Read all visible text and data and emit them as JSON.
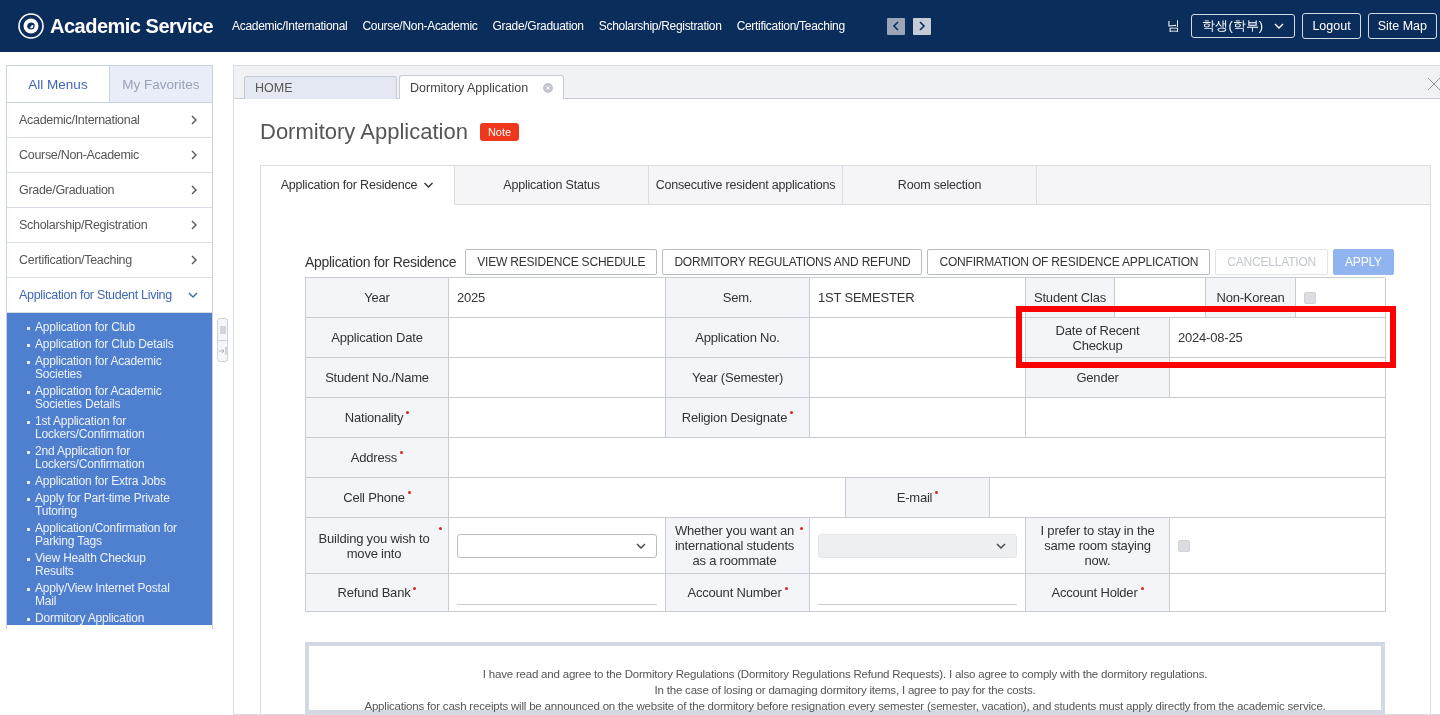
{
  "header": {
    "title": "Academic Service",
    "nav": [
      "Academic/International",
      "Course/Non-Academic",
      "Grade/Graduation",
      "Scholarship/Registration",
      "Certification/Teaching"
    ],
    "suffix": "님",
    "role_select": "학생(학부)",
    "buttons": [
      "Logout",
      "Site Map"
    ]
  },
  "sidebar": {
    "tabs": [
      {
        "label": "All Menus",
        "selected": true
      },
      {
        "label": "My Favorites",
        "selected": false
      }
    ],
    "items": [
      {
        "label": "Academic/International",
        "expanded": false
      },
      {
        "label": "Course/Non-Academic",
        "expanded": false
      },
      {
        "label": "Grade/Graduation",
        "expanded": false
      },
      {
        "label": "Scholarship/Registration",
        "expanded": false
      },
      {
        "label": "Certification/Teaching",
        "expanded": false
      },
      {
        "label": "Application for Student Living",
        "expanded": true,
        "children": [
          "Application for Club",
          "Application for Club Details",
          "Application for Academic Societies",
          "Application for Academic Societies Details",
          "1st Application for Lockers/Confirmation",
          "2nd Application for Lockers/Confirmation",
          "Application for Extra Jobs",
          "Apply for Part-time Private Tutoring",
          "Application/Confirmation for Parking Tags",
          "View Health Checkup Results",
          "Apply/View Internet Postal Mail",
          "Dormitory Application"
        ]
      }
    ]
  },
  "page_tabs": [
    {
      "label": "HOME",
      "selected": false,
      "closable": false
    },
    {
      "label": "Dormitory Application",
      "selected": true,
      "closable": true
    }
  ],
  "page": {
    "title": "Dormitory Application",
    "badge": "Note",
    "tabs": [
      {
        "label": "Application for Residence",
        "selected": true,
        "dropdown": true
      },
      {
        "label": "Application Status",
        "selected": false,
        "dropdown": false
      },
      {
        "label": "Consecutive resident applications",
        "selected": false,
        "dropdown": false
      },
      {
        "label": "Room selection",
        "selected": false,
        "dropdown": false
      }
    ],
    "section_title": "Application for Residence",
    "buttons": [
      {
        "label": "VIEW RESIDENCE SCHEDULE",
        "kind": "outline",
        "disabled": false
      },
      {
        "label": "DORMITORY REGULATIONS AND REFUND",
        "kind": "outline",
        "disabled": false
      },
      {
        "label": "CONFIRMATION OF RESIDENCE APPLICATION",
        "kind": "outline",
        "disabled": false
      },
      {
        "label": "CANCELLATION",
        "kind": "outline",
        "disabled": true
      },
      {
        "label": "APPLY",
        "kind": "primary",
        "disabled": true
      }
    ],
    "form": [
      {
        "cells": [
          {
            "kind": "label",
            "text": "Year",
            "required": false
          },
          {
            "kind": "text",
            "text": "2025"
          },
          {
            "kind": "label",
            "text": "Sem.",
            "required": false
          },
          {
            "kind": "text",
            "text": "1ST SEMESTER"
          },
          {
            "kind": "label",
            "text": "Student Clas",
            "required": false
          },
          {
            "kind": "empty"
          },
          {
            "kind": "label",
            "text": "Non-Korean",
            "required": false
          },
          {
            "kind": "checkbox",
            "checked": false,
            "disabled": true
          }
        ]
      },
      {
        "cells": [
          {
            "kind": "label",
            "text": "Application Date",
            "required": false
          },
          {
            "kind": "empty"
          },
          {
            "kind": "label",
            "text": "Application No.",
            "required": false
          },
          {
            "kind": "empty"
          },
          {
            "kind": "label",
            "text": "Date of Recent Checkup",
            "required": false,
            "highlighted": true
          },
          {
            "kind": "text",
            "text": "2024-08-25",
            "highlighted": true
          }
        ]
      },
      {
        "cells": [
          {
            "kind": "label",
            "text": "Student No./Name",
            "required": false
          },
          {
            "kind": "empty"
          },
          {
            "kind": "label",
            "text": "Year (Semester)",
            "required": false
          },
          {
            "kind": "empty"
          },
          {
            "kind": "label",
            "text": "Gender",
            "required": false
          },
          {
            "kind": "empty"
          }
        ]
      },
      {
        "cells": [
          {
            "kind": "label",
            "text": "Nationality",
            "required": true
          },
          {
            "kind": "empty"
          },
          {
            "kind": "label",
            "text": "Religion Designate",
            "required": true
          },
          {
            "kind": "empty"
          },
          {
            "kind": "empty"
          }
        ]
      },
      {
        "cells": [
          {
            "kind": "label",
            "text": "Address",
            "required": true
          },
          {
            "kind": "empty"
          }
        ]
      },
      {
        "cells": [
          {
            "kind": "label",
            "text": "Cell Phone",
            "required": true
          },
          {
            "kind": "empty"
          },
          {
            "kind": "label",
            "text": "E-mail",
            "required": true
          },
          {
            "kind": "empty"
          }
        ]
      },
      {
        "cells": [
          {
            "kind": "label",
            "text": "Building you wish to move into",
            "required": true
          },
          {
            "kind": "select",
            "disabled": false
          },
          {
            "kind": "label",
            "text": "Whether you want an international students as a roommate",
            "required": true
          },
          {
            "kind": "select",
            "disabled": true
          },
          {
            "kind": "label",
            "text": "I prefer to stay in the same room staying now.",
            "required": false
          },
          {
            "kind": "checkbox",
            "checked": false,
            "disabled": true
          }
        ]
      },
      {
        "cells": [
          {
            "kind": "label",
            "text": "Refund Bank",
            "required": true
          },
          {
            "kind": "input"
          },
          {
            "kind": "label",
            "text": "Account Number",
            "required": true
          },
          {
            "kind": "input"
          },
          {
            "kind": "label",
            "text": "Account Holder",
            "required": true
          },
          {
            "kind": "empty"
          }
        ]
      }
    ],
    "agreement": [
      "I have read and agree to the Dormitory Regulations (Dormitory Regulations Refund Requests). I also agree to comply with the dormitory regulations.",
      "In the case of losing or damaging dormitory items, I agree to pay for the costs.",
      "Applications for cash receipts will be announced on the website of the dormitory before resignation every semester (semester, vacation), and students must apply directly from the academic service."
    ]
  }
}
